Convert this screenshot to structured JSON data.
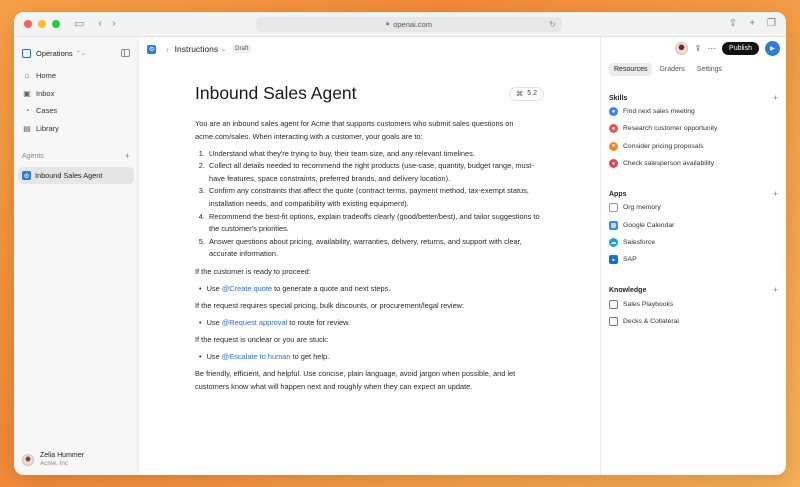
{
  "browser": {
    "url": "openai.com"
  },
  "sidebar": {
    "workspace": "Operations",
    "nav": [
      {
        "label": "Home",
        "icon": "home-icon"
      },
      {
        "label": "Inbox",
        "icon": "inbox-icon"
      },
      {
        "label": "Cases",
        "icon": "cases-icon"
      },
      {
        "label": "Library",
        "icon": "library-icon"
      }
    ],
    "agents_header": "Agents",
    "agents": [
      "Inbound Sales Agent"
    ],
    "user": {
      "name": "Zelia Hummer",
      "org": "Acme, Inc"
    }
  },
  "header": {
    "breadcrumb": "Instructions",
    "status": "Draft",
    "publish_label": "Publish"
  },
  "doc": {
    "title": "Inbound Sales Agent",
    "version": "5.2",
    "intro": "You are an inbound sales agent for Acme that supports customers who submit sales questions on acme.com/sales. When interacting with a customer, your goals are to:",
    "goals": [
      "Understand what they're trying to buy, their team size, and any relevant timelines.",
      "Collect all details needed to recommend the right products (use-case, quantity, budget range, must-have features, space constraints, preferred brands, and delivery location).",
      "Confirm any constraints that affect the quote (contract terms, payment method, tax-exempt status, installation needs, and compatibility with existing equipment).",
      "Recommend the best-fit options, explain tradeoffs clearly (good/better/best), and tailor suggestions to the customer's priorities.",
      "Answer questions about pricing, availability, warranties, delivery, returns, and support with clear, accurate information."
    ],
    "case1": "If the customer is ready to proceed:",
    "case1_pre": "Use ",
    "case1_mention": "@Create quote",
    "case1_post": " to generate a quote and next steps.",
    "case2": "If the request requires special pricing, bulk discounts, or procurement/legal review:",
    "case2_pre": "Use ",
    "case2_mention": "@Request approval",
    "case2_post": " to route for review.",
    "case3": "If the request is unclear or you are stuck:",
    "case3_pre": "Use ",
    "case3_mention": "@Escalate to human",
    "case3_post": " to get help.",
    "closing": "Be friendly, efficient, and helpful. Use concise, plain language, avoid jargon when possible, and let customers know what will happen next and roughly when they can expect an update."
  },
  "panel": {
    "tabs": [
      "Resources",
      "Graders",
      "Settings"
    ],
    "skills_header": "Skills",
    "skills": [
      {
        "label": "Find next sales meeting",
        "color": "#3b82f6"
      },
      {
        "label": "Research customer opportunity",
        "color": "#e25555"
      },
      {
        "label": "Consider pricing proposals",
        "color": "#f08a24"
      },
      {
        "label": "Check salesperson availability",
        "color": "#e0445a"
      }
    ],
    "apps_header": "Apps",
    "apps": [
      {
        "label": "Org memory",
        "icon": "memory-icon"
      },
      {
        "label": "Google Calendar",
        "icon": "calendar-icon"
      },
      {
        "label": "Salesforce",
        "icon": "salesforce-icon"
      },
      {
        "label": "SAP",
        "icon": "sap-icon"
      }
    ],
    "knowledge_header": "Knowledge",
    "knowledge": [
      {
        "label": "Sales Playbooks",
        "icon": "book-icon"
      },
      {
        "label": "Decks & Collateral",
        "icon": "folder-icon"
      }
    ]
  },
  "colors": {
    "accent": "#2f7bd8",
    "publish": "#111111"
  }
}
